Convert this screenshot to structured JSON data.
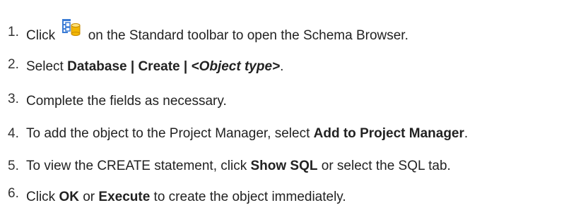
{
  "steps": [
    {
      "number": "1.",
      "parts": {
        "a": "Click ",
        "b": " on the Standard toolbar to open the Schema Browser."
      },
      "icon": "schema-browser-icon"
    },
    {
      "number": "2.",
      "parts": {
        "a": "Select ",
        "b": "Database | Create | ",
        "c": "<Object type>",
        "d": "."
      }
    },
    {
      "number": "3.",
      "parts": {
        "a": "Complete the fields as necessary."
      }
    },
    {
      "number": "4.",
      "parts": {
        "a": "To add the object to the Project Manager, select ",
        "b": "Add to Project Manager",
        "c": "."
      }
    },
    {
      "number": "5.",
      "parts": {
        "a": "To view the CREATE statement, click ",
        "b": "Show SQL",
        "c": " or select the SQL tab."
      }
    },
    {
      "number": "6.",
      "parts": {
        "a": "Click ",
        "b": "OK",
        "c": " or ",
        "d": "Execute",
        "e": " to create the object immediately."
      }
    }
  ],
  "colors": {
    "text": "#222222",
    "icon_blue": "#3a7bd5",
    "icon_yellow": "#f2b705"
  }
}
